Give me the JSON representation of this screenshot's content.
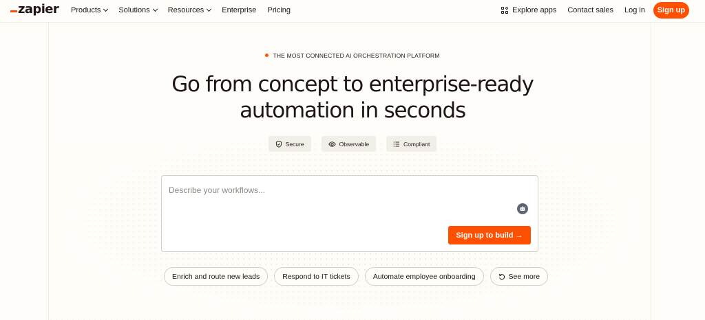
{
  "brand": {
    "name": "zapier",
    "accent": "#ff4f00"
  },
  "nav": {
    "left": [
      {
        "label": "Products",
        "dropdown": true
      },
      {
        "label": "Solutions",
        "dropdown": true
      },
      {
        "label": "Resources",
        "dropdown": true
      },
      {
        "label": "Enterprise",
        "dropdown": false
      },
      {
        "label": "Pricing",
        "dropdown": false
      }
    ],
    "explore_label": "Explore apps",
    "contact_label": "Contact sales",
    "login_label": "Log in",
    "signup_label": "Sign up"
  },
  "hero": {
    "eyebrow": "THE MOST CONNECTED AI ORCHESTRATION PLATFORM",
    "headline_line1": "Go from concept to enterprise-ready",
    "headline_line2": "automation in seconds",
    "badges": [
      {
        "label": "Secure",
        "icon": "shield-icon"
      },
      {
        "label": "Observable",
        "icon": "eye-icon"
      },
      {
        "label": "Compliant",
        "icon": "list-icon"
      }
    ],
    "prompt": {
      "placeholder": "Describe your workflows...",
      "value": "",
      "bot_icon": "bot-icon",
      "build_label": "Sign up to build →"
    },
    "suggestions": [
      "Enrich and route new leads",
      "Respond to IT tickets",
      "Automate employee onboarding"
    ],
    "see_more_label": "See more"
  }
}
